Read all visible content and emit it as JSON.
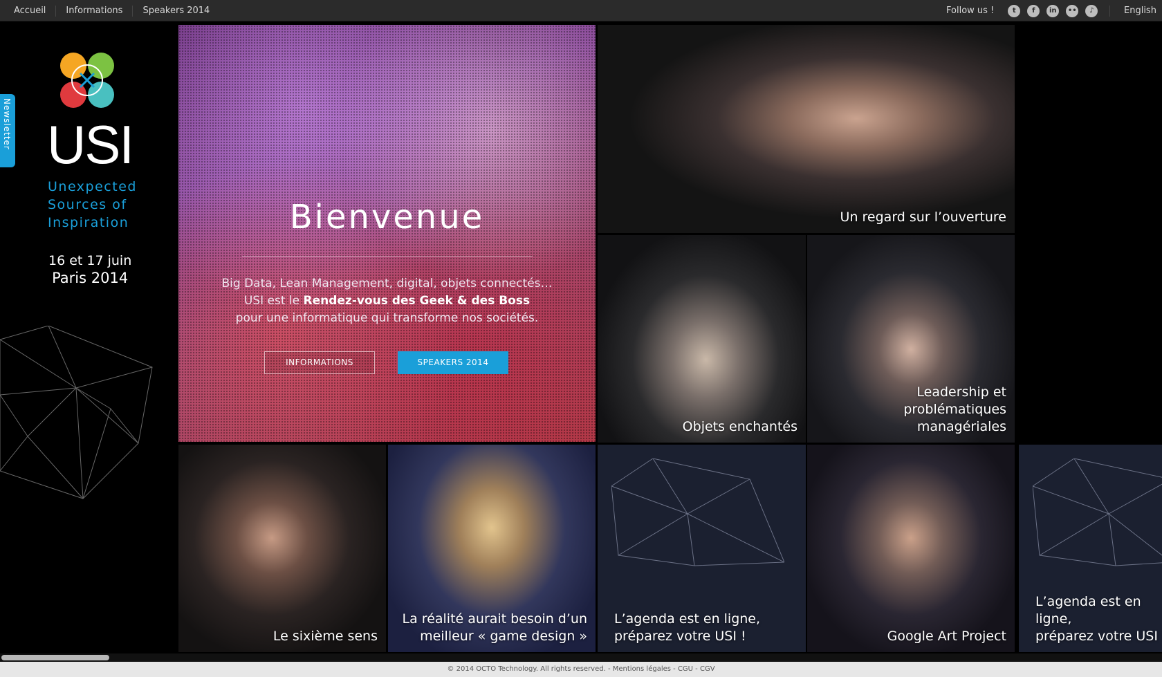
{
  "topnav": {
    "items": [
      "Accueil",
      "Informations",
      "Speakers 2014"
    ],
    "follow_label": "Follow us !",
    "social": [
      {
        "name": "twitter-icon",
        "glyph": "t"
      },
      {
        "name": "facebook-icon",
        "glyph": "f"
      },
      {
        "name": "linkedin-icon",
        "glyph": "in"
      },
      {
        "name": "flickr-icon",
        "glyph": "••"
      },
      {
        "name": "itunes-icon",
        "glyph": "♪"
      }
    ],
    "language": "English"
  },
  "sidebar": {
    "newsletter": "Newsletter",
    "brand": "USI",
    "tagline": [
      "Unexpected",
      "Sources of",
      "Inspiration"
    ],
    "dates": "16 et 17 juin",
    "city": "Paris 2014",
    "colors": {
      "accent": "#1a9fd9",
      "orange": "#f5a623",
      "green": "#7cc242",
      "red": "#e03a3e",
      "teal": "#49c0c0"
    }
  },
  "hero": {
    "title": "Bienvenue",
    "line1": "Big Data, Lean Management, digital, objets connectés…",
    "line2_prefix": "USI est le ",
    "line2_bold": "Rendez-vous des Geek & des Boss",
    "line3": "pour une informatique qui transforme nos sociétés.",
    "btn_info": "INFORMATIONS",
    "btn_speakers": "SPEAKERS 2014"
  },
  "tiles": {
    "ouverture": "Un regard sur l’ouverture",
    "objets": "Objets enchantés",
    "leadership": [
      "Leadership et",
      "problématiques",
      "managériales"
    ],
    "sixieme": "Le sixième sens",
    "realite": [
      "La réalité aurait besoin d’un",
      "meilleur « game design »"
    ],
    "agenda1": [
      "L’agenda est en ligne,",
      "préparez votre USI !"
    ],
    "google": "Google Art Project",
    "agenda2": [
      "L’agenda est en ligne,",
      "préparez votre USI !"
    ]
  },
  "footer": {
    "copyright": "© 2014 OCTO Technology. All rights reserved. - ",
    "mentions": "Mentions légales",
    "sep1": " - ",
    "cgu": "CGU",
    "sep2": " - ",
    "cgv": "CGV"
  }
}
